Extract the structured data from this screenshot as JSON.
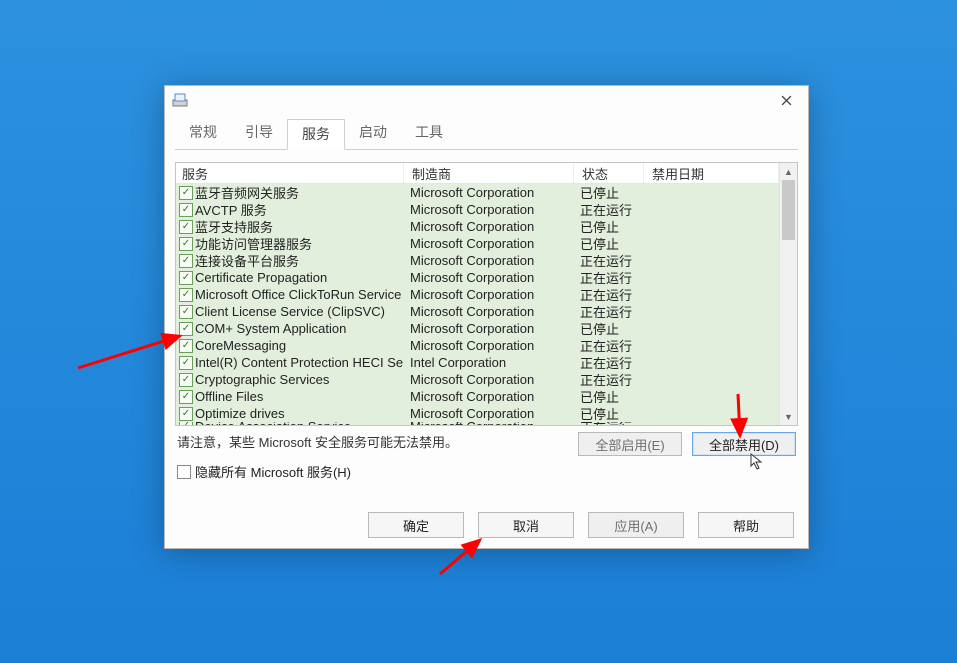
{
  "tabs": {
    "general": "常规",
    "boot": "引导",
    "services": "服务",
    "startup": "启动",
    "tools": "工具"
  },
  "columns": {
    "service": "服务",
    "manufacturer": "制造商",
    "status": "状态",
    "disable_date": "禁用日期"
  },
  "rows": [
    {
      "name": "蓝牙音频网关服务",
      "mfr": "Microsoft Corporation",
      "status": "已停止"
    },
    {
      "name": "AVCTP 服务",
      "mfr": "Microsoft Corporation",
      "status": "正在运行"
    },
    {
      "name": "蓝牙支持服务",
      "mfr": "Microsoft Corporation",
      "status": "已停止"
    },
    {
      "name": "功能访问管理器服务",
      "mfr": "Microsoft Corporation",
      "status": "已停止"
    },
    {
      "name": "连接设备平台服务",
      "mfr": "Microsoft Corporation",
      "status": "正在运行"
    },
    {
      "name": "Certificate Propagation",
      "mfr": "Microsoft Corporation",
      "status": "正在运行"
    },
    {
      "name": "Microsoft Office ClickToRun Service",
      "mfr": "Microsoft Corporation",
      "status": "正在运行"
    },
    {
      "name": "Client License Service (ClipSVC)",
      "mfr": "Microsoft Corporation",
      "status": "正在运行"
    },
    {
      "name": "COM+ System Application",
      "mfr": "Microsoft Corporation",
      "status": "已停止"
    },
    {
      "name": "CoreMessaging",
      "mfr": "Microsoft Corporation",
      "status": "正在运行"
    },
    {
      "name": "Intel(R) Content Protection HECI Se...",
      "mfr": "Intel Corporation",
      "status": "正在运行"
    },
    {
      "name": "Cryptographic Services",
      "mfr": "Microsoft Corporation",
      "status": "正在运行"
    },
    {
      "name": "Offline Files",
      "mfr": "Microsoft Corporation",
      "status": "已停止"
    },
    {
      "name": "Optimize drives",
      "mfr": "Microsoft Corporation",
      "status": "已停止"
    }
  ],
  "lastrow": {
    "name": "Device Association Service",
    "mfr": "Microsoft Corporation",
    "status": "正在运行"
  },
  "note": "请注意，某些 Microsoft 安全服务可能无法禁用。",
  "hide_ms_label": "隐藏所有 Microsoft 服务(H)",
  "buttons": {
    "enable_all": "全部启用(E)",
    "disable_all": "全部禁用(D)",
    "ok": "确定",
    "cancel": "取消",
    "apply": "应用(A)",
    "help": "帮助"
  }
}
